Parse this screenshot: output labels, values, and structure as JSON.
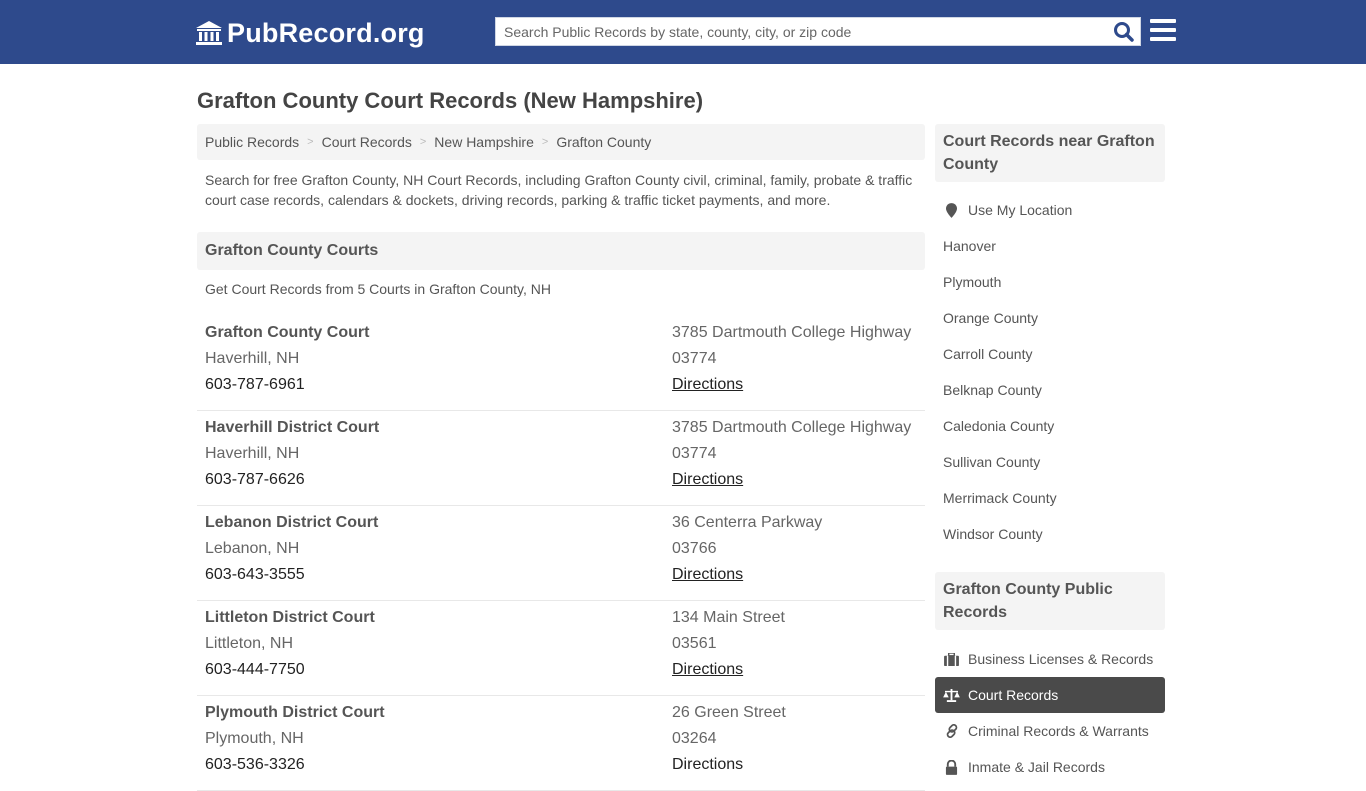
{
  "header": {
    "brand": "PubRecord.org",
    "search_placeholder": "Search Public Records by state, county, city, or zip code",
    "colors": {
      "navbar": "#2e4a8c",
      "search_icon": "#2e4a8c",
      "active_item": "#4a4a4a"
    }
  },
  "page": {
    "title": "Grafton County Court Records (New Hampshire)",
    "breadcrumb": [
      "Public Records",
      "Court Records",
      "New Hampshire",
      "Grafton County"
    ],
    "intro": "Search for free Grafton County, NH Court Records, including Grafton County civil, criminal, family, probate & traffic court case records, calendars & dockets, driving records, parking & traffic ticket payments, and more."
  },
  "courts_section": {
    "heading": "Grafton County Courts",
    "subheading": "Get Court Records from 5 Courts in Grafton County, NH",
    "directions_label": "Directions",
    "courts": [
      {
        "name": "Grafton County Court",
        "city": "Haverhill, NH",
        "phone": "603-787-6961",
        "address": "3785 Dartmouth College Highway",
        "zip": "03774"
      },
      {
        "name": "Haverhill District Court",
        "city": "Haverhill, NH",
        "phone": "603-787-6626",
        "address": "3785 Dartmouth College Highway",
        "zip": "03774"
      },
      {
        "name": "Lebanon District Court",
        "city": "Lebanon, NH",
        "phone": "603-643-3555",
        "address": "36 Centerra Parkway",
        "zip": "03766"
      },
      {
        "name": "Littleton District Court",
        "city": "Littleton, NH",
        "phone": "603-444-7750",
        "address": "134 Main Street",
        "zip": "03561"
      },
      {
        "name": "Plymouth District Court",
        "city": "Plymouth, NH",
        "phone": "603-536-3326",
        "address": "26 Green Street",
        "zip": "03264"
      }
    ]
  },
  "sidebar": {
    "nearby": {
      "heading": "Court Records near Grafton County",
      "use_location": "Use My Location",
      "items": [
        "Hanover",
        "Plymouth",
        "Orange County",
        "Carroll County",
        "Belknap County",
        "Caledonia County",
        "Sullivan County",
        "Merrimack County",
        "Windsor County"
      ]
    },
    "public_records": {
      "heading": "Grafton County Public Records",
      "items": [
        {
          "label": "Business Licenses & Records",
          "icon": "briefcase-icon",
          "active": false
        },
        {
          "label": "Court Records",
          "icon": "scale-icon",
          "active": true
        },
        {
          "label": "Criminal Records & Warrants",
          "icon": "link-icon",
          "active": false
        },
        {
          "label": "Inmate & Jail Records",
          "icon": "lock-icon",
          "active": false
        }
      ]
    }
  }
}
